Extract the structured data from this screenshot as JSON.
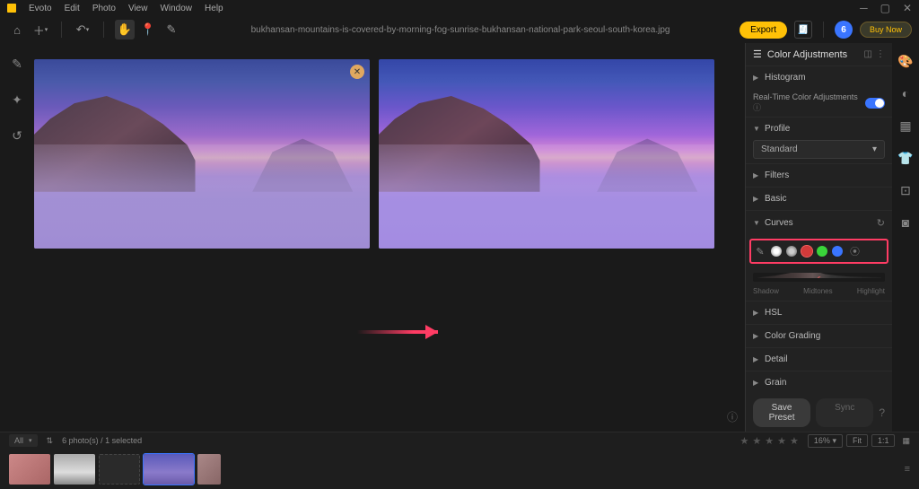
{
  "menubar": {
    "app": "Evoto",
    "items": [
      "Edit",
      "Photo",
      "View",
      "Window",
      "Help"
    ]
  },
  "filename": "bukhansan-mountains-is-covered-by-morning-fog-sunrise-bukhansan-national-park-seoul-south-korea.jpg",
  "toolbar": {
    "export": "Export",
    "avatar_badge": "6",
    "buy": "Buy Now"
  },
  "panel": {
    "title": "Color Adjustments",
    "histogram": "Histogram",
    "rt_label": "Real-Time Color Adjustments",
    "profile": "Profile",
    "profile_value": "Standard",
    "filters": "Filters",
    "basic": "Basic",
    "curves": "Curves",
    "hsl": "HSL",
    "color_grading": "Color Grading",
    "detail": "Detail",
    "grain": "Grain",
    "hist_labels": [
      "Shadow",
      "Midtones",
      "Highlight"
    ],
    "save_preset": "Save Preset",
    "sync": "Sync"
  },
  "curves_channels": [
    {
      "name": "rgb-channel",
      "style": "background: radial-gradient(circle, #fff 30%, #888 100%);"
    },
    {
      "name": "luma-channel",
      "style": "background: radial-gradient(circle, #ccc 30%, #555 100%);"
    },
    {
      "name": "red-channel",
      "style": "background: #d43a3a; outline: 1px solid #ff6060;"
    },
    {
      "name": "green-channel",
      "style": "background: #3ad43a;"
    },
    {
      "name": "blue-channel",
      "style": "background: #3a75ff;"
    }
  ],
  "bottom": {
    "filter": "All",
    "count": "6 photo(s) / 1 selected",
    "zoom": "16%",
    "fit": "Fit",
    "onetoone": "1:1"
  }
}
